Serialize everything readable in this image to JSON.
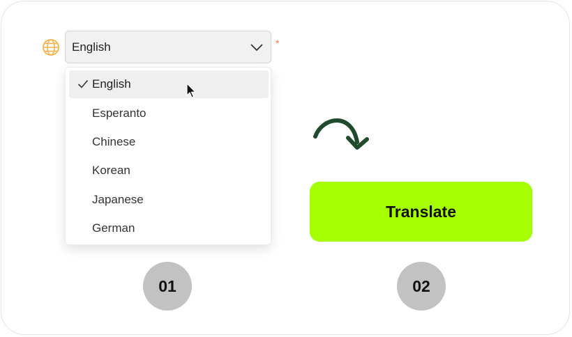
{
  "language_select": {
    "selected_value": "English",
    "required_mark": "*",
    "options": [
      {
        "label": "English",
        "selected": true
      },
      {
        "label": "Esperanto",
        "selected": false
      },
      {
        "label": "Chinese",
        "selected": false
      },
      {
        "label": "Korean",
        "selected": false
      },
      {
        "label": "Japanese",
        "selected": false
      },
      {
        "label": "German",
        "selected": false
      }
    ]
  },
  "translate_button": {
    "label": "Translate"
  },
  "steps": [
    "01",
    "02"
  ],
  "colors": {
    "accent": "#a6ff00",
    "arrow": "#1f4a2c",
    "badge": "#c2c2c2",
    "required": "#ef7a3a",
    "globe": "#f4b247"
  },
  "icons": [
    "globe-icon",
    "chevron-down-icon",
    "check-icon",
    "mouse-cursor-icon",
    "curved-arrow-icon"
  ]
}
